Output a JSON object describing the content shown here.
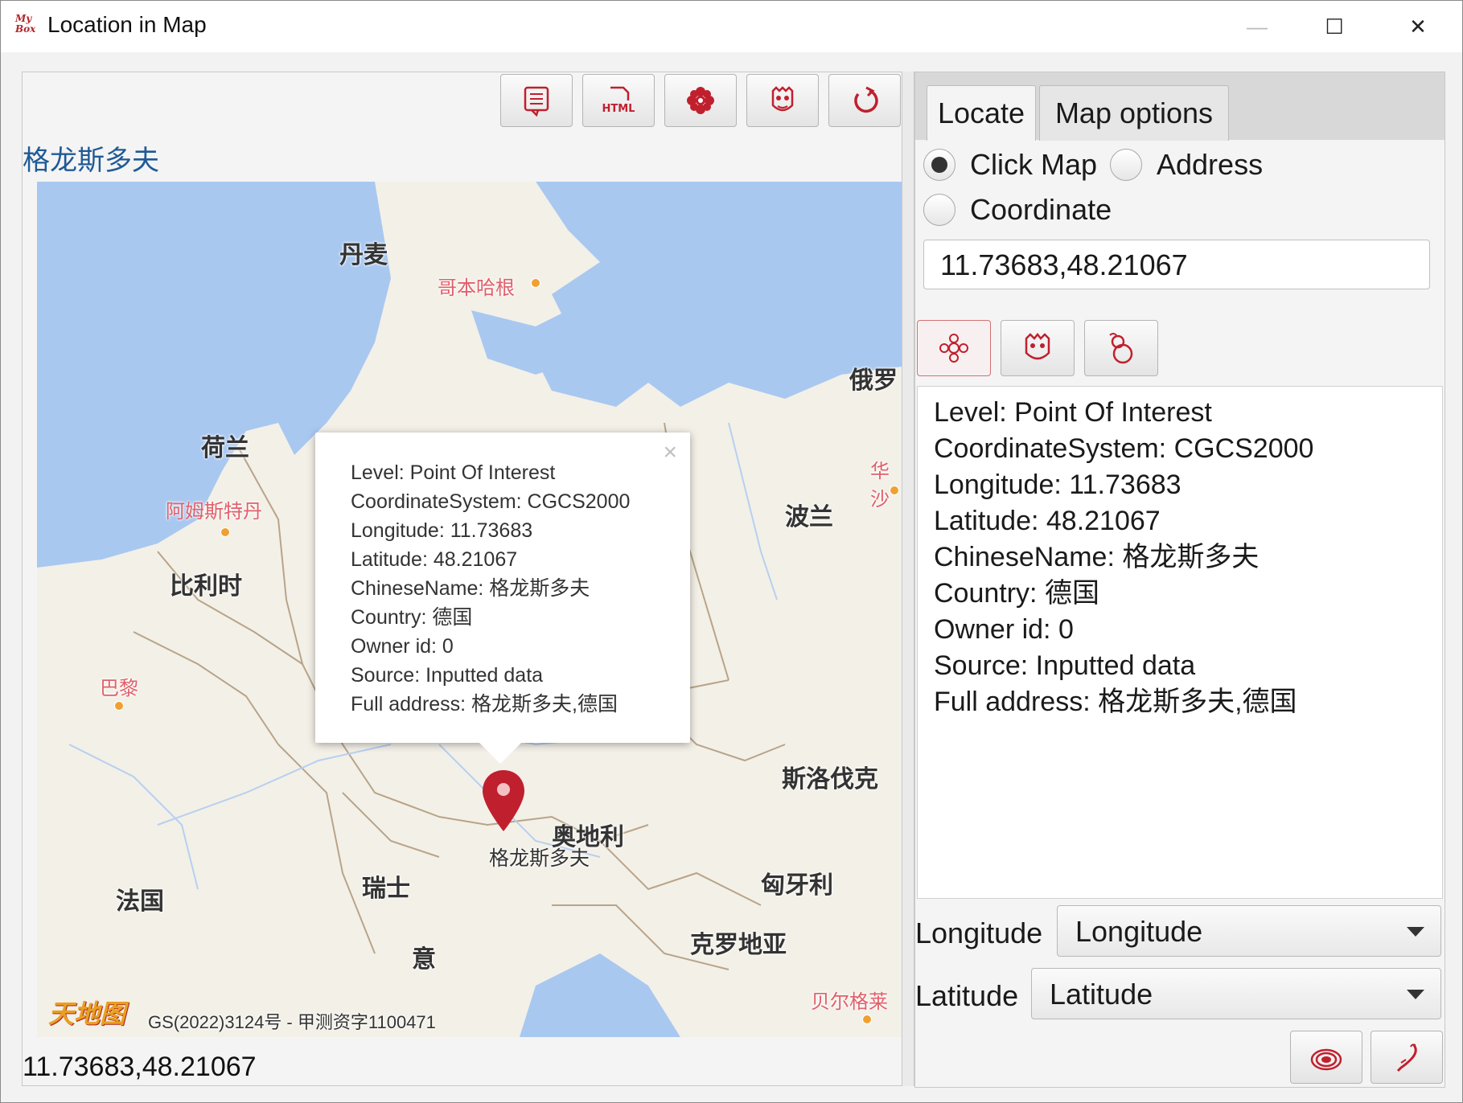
{
  "window": {
    "title": "Location in Map",
    "logo_text": "My Box",
    "minimize_glyph": "—",
    "maximize_glyph": "☐",
    "close_glyph": "✕"
  },
  "toolbar": {
    "buttons": [
      "info-icon",
      "html-icon",
      "peony-icon",
      "mask-icon",
      "refresh-icon"
    ]
  },
  "map": {
    "title": "格龙斯多夫",
    "countries": [
      "丹麦",
      "荷兰",
      "比利时",
      "波兰",
      "斯洛伐克",
      "奥地利",
      "瑞士",
      "法国",
      "匈牙利",
      "克罗地亚",
      "意",
      "俄罗"
    ],
    "cities": [
      "哥本哈根",
      "阿姆斯特丹",
      "巴黎",
      "华沙",
      "贝尔格莱"
    ],
    "marker_label": "格龙斯多夫",
    "logo_text": "天地图",
    "copyright": "GS(2022)3124号 - 甲测资字1100471",
    "popup": {
      "close": "×",
      "lines": [
        "Level: Point Of Interest",
        "CoordinateSystem: CGCS2000",
        "Longitude: 11.73683",
        "Latitude: 48.21067",
        "ChineseName: 格龙斯多夫",
        "Country: 德国",
        "Owner id: 0",
        "Source: Inputted data",
        "Full address: 格龙斯多夫,德国"
      ]
    }
  },
  "status": {
    "coordinate": "11.73683,48.21067"
  },
  "right": {
    "tabs": [
      "Locate",
      "Map options"
    ],
    "active_tab": "Locate",
    "radios": [
      {
        "label": "Click Map",
        "selected": true
      },
      {
        "label": "Address",
        "selected": false
      },
      {
        "label": "Coordinate",
        "selected": false
      }
    ],
    "coordinate_input": "11.73683,48.21067",
    "action_buttons": [
      "knot-icon",
      "mask-icon",
      "gourd-icon"
    ],
    "info_lines": [
      "Level: Point Of Interest",
      "CoordinateSystem: CGCS2000",
      "Longitude: 11.73683",
      "Latitude: 48.21067",
      "ChineseName: 格龙斯多夫",
      "Country: 德国",
      "Owner id: 0",
      "Source: Inputted data",
      "Full address: 格龙斯多夫,德国"
    ],
    "longitude_label": "Longitude",
    "longitude_value": "Longitude",
    "latitude_label": "Latitude",
    "latitude_value": "Latitude",
    "bottom_buttons": [
      "swirl-icon",
      "feather-icon"
    ]
  },
  "colors": {
    "accent_red": "#c0202e",
    "water": "#a9c8f0",
    "land": "#f3f0e8",
    "title_blue": "#1f5a96"
  }
}
